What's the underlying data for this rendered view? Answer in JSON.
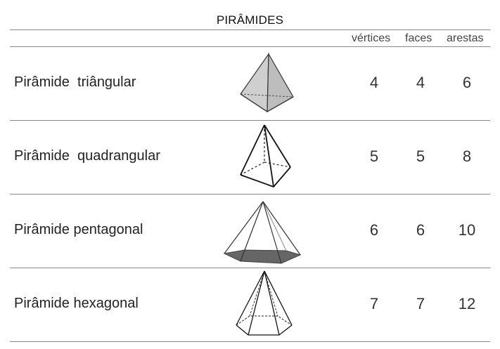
{
  "title": "PIRÂMIDES",
  "columns": {
    "vertices": "vértices",
    "faces": "faces",
    "arestas": "arestas"
  },
  "rows": [
    {
      "name": "Pirâmide  triângular",
      "vertices": "4",
      "faces": "4",
      "arestas": "6"
    },
    {
      "name": "Pirâmide  quadrangular",
      "vertices": "5",
      "faces": "5",
      "arestas": "8"
    },
    {
      "name": "Pirâmide pentagonal",
      "vertices": "6",
      "faces": "6",
      "arestas": "10"
    },
    {
      "name": "Pirâmide hexagonal",
      "vertices": "7",
      "faces": "7",
      "arestas": "12"
    }
  ]
}
